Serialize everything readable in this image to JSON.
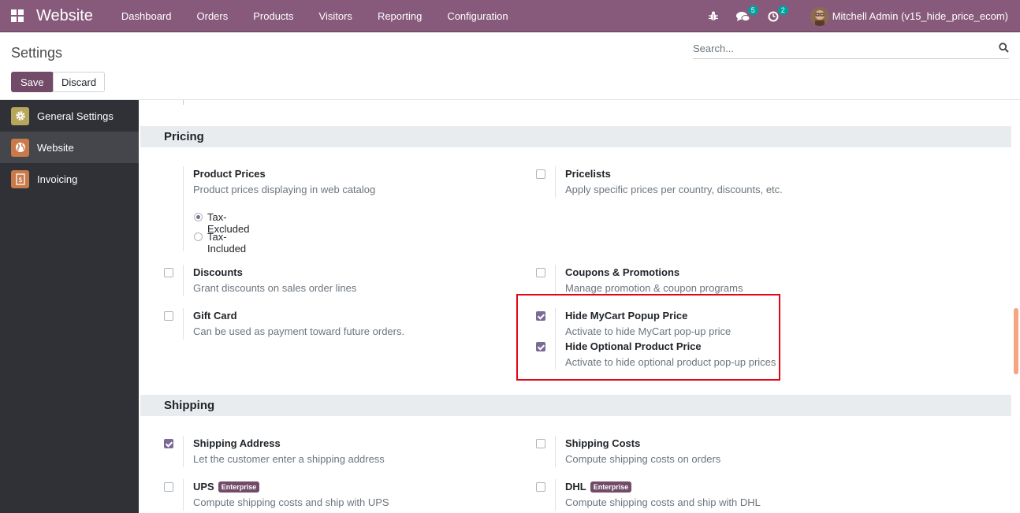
{
  "navbar": {
    "brand": "Website",
    "menu": [
      "Dashboard",
      "Orders",
      "Products",
      "Visitors",
      "Reporting",
      "Configuration"
    ],
    "messages_count": "5",
    "activities_count": "2",
    "user_name": "Mitchell Admin (v15_hide_price_ecom)"
  },
  "control_panel": {
    "title": "Settings",
    "search_placeholder": "Search...",
    "save_label": "Save",
    "discard_label": "Discard"
  },
  "sidebar": {
    "items": [
      {
        "label": "General Settings",
        "icon": "gear-icon",
        "color": "#b8a65c"
      },
      {
        "label": "Website",
        "icon": "globe-icon",
        "color": "#c97a4a"
      },
      {
        "label": "Invoicing",
        "icon": "invoice-icon",
        "color": "#c97a4a"
      }
    ]
  },
  "pricing": {
    "header": "Pricing",
    "product_prices": {
      "title": "Product Prices",
      "desc": "Product prices displaying in web catalog",
      "options": [
        "Tax-Excluded",
        "Tax-Included"
      ],
      "selected": "Tax-Excluded"
    },
    "pricelists": {
      "title": "Pricelists",
      "desc": "Apply specific prices per country, discounts, etc.",
      "checked": false
    },
    "discounts": {
      "title": "Discounts",
      "desc": "Grant discounts on sales order lines",
      "checked": false
    },
    "coupons": {
      "title": "Coupons & Promotions",
      "desc": "Manage promotion & coupon programs",
      "checked": false
    },
    "gift_card": {
      "title": "Gift Card",
      "desc": "Can be used as payment toward future orders.",
      "checked": false
    },
    "hide_mycart": {
      "title": "Hide MyCart Popup Price",
      "desc": "Activate to hide MyCart pop-up price",
      "checked": true
    },
    "hide_optional": {
      "title": "Hide Optional Product Price",
      "desc": "Activate to hide optional product pop-up prices",
      "checked": true
    }
  },
  "shipping": {
    "header": "Shipping",
    "shipping_address": {
      "title": "Shipping Address",
      "desc": "Let the customer enter a shipping address",
      "checked": true
    },
    "shipping_costs": {
      "title": "Shipping Costs",
      "desc": "Compute shipping costs on orders",
      "checked": false
    },
    "ups": {
      "title": "UPS",
      "badge": "Enterprise",
      "desc": "Compute shipping costs and ship with UPS",
      "checked": false
    },
    "dhl": {
      "title": "DHL",
      "badge": "Enterprise",
      "desc": "Compute shipping costs and ship with DHL",
      "checked": false
    }
  },
  "colors": {
    "navbar": "#875a7b",
    "primary": "#714b67",
    "checkbox": "#7c6a96",
    "highlight": "#e30613",
    "sidebar": "#2f3136"
  }
}
